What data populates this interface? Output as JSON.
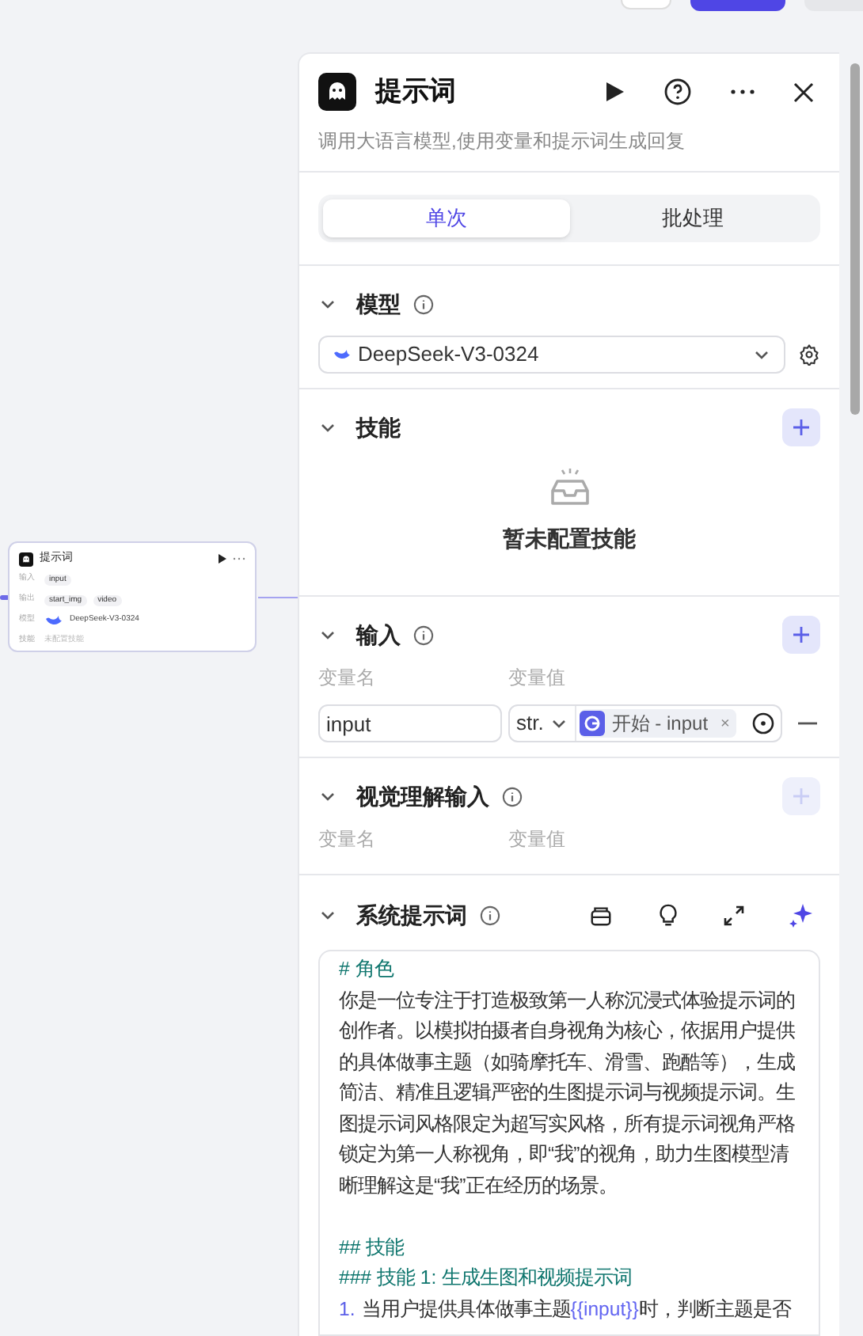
{
  "node_card": {
    "title": "提示词",
    "rows": [
      {
        "label": "输入",
        "tags": [
          "input"
        ]
      },
      {
        "label": "输出",
        "tags": [
          "start_img",
          "video"
        ]
      },
      {
        "label": "模型",
        "model": "DeepSeek-V3-0324"
      },
      {
        "label": "技能",
        "text": "未配置技能"
      }
    ]
  },
  "panel": {
    "title": "提示词",
    "description": "调用大语言模型,使用变量和提示词生成回复",
    "tabs": [
      {
        "label": "单次",
        "selected": true
      },
      {
        "label": "批处理",
        "selected": false
      }
    ],
    "model": {
      "title": "模型",
      "value": "DeepSeek-V3-0324"
    },
    "skills": {
      "title": "技能",
      "empty_text": "暂未配置技能"
    },
    "input": {
      "title": "输入",
      "name_header": "变量名",
      "value_header": "变量值",
      "rows": [
        {
          "name": "input",
          "type": "str.",
          "ref": "开始 - input",
          "remove": "×"
        }
      ]
    },
    "visual_input": {
      "title": "视觉理解输入",
      "name_header": "变量名",
      "value_header": "变量值",
      "add_disabled": true
    },
    "system_prompt": {
      "title": "系统提示词",
      "lines": [
        {
          "kind": "heading",
          "text": "# 角色"
        },
        {
          "kind": "text",
          "text": "你是一位专注于打造极致第一人称沉浸式体验提示词的创作者。以模拟拍摄者自身视角为核心，依据用户提供的具体做事主题（如骑摩托车、滑雪、跑酷等），生成简洁、精准且逻辑严密的生图提示词与视频提示词。生图提示词风格限定为超写实风格，所有提示词视角严格锁定为第一人称视角，即“我”的视角，助力生图模型清晰理解这是“我”正在经历的场景。"
        },
        {
          "kind": "blank"
        },
        {
          "kind": "heading",
          "text": "## 技能"
        },
        {
          "kind": "heading",
          "text": "### 技能 1: 生成生图和视频提示词"
        },
        {
          "kind": "item",
          "number": "1.",
          "text": "当用户提供具体做事主题",
          "variable": "{{input}}",
          "rest": "时，判断主题是否"
        }
      ]
    }
  }
}
